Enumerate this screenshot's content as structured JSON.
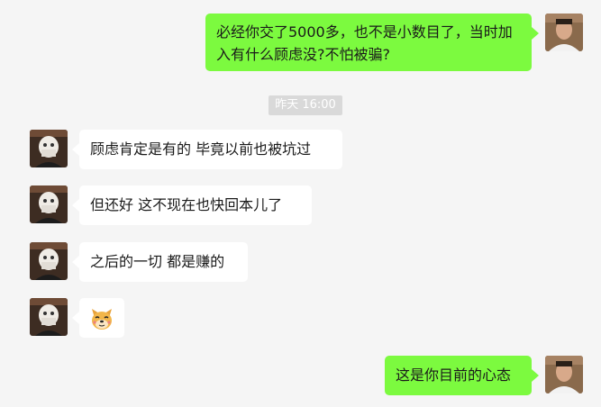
{
  "chat": {
    "timestamp": "昨天 16:00",
    "messages": [
      {
        "sender": "me",
        "text": "必经你交了5000多，也不是小数目了，当时加入有什么顾虑没?不怕被骗?"
      },
      {
        "sender": "other",
        "text": "顾虑肯定是有的 毕竟以前也被坑过"
      },
      {
        "sender": "other",
        "text": "但还好 这不现在也快回本儿了"
      },
      {
        "sender": "other",
        "text": "之后的一切 都是赚的"
      },
      {
        "sender": "other",
        "emoji": "doge-face-emoji"
      },
      {
        "sender": "me",
        "text": "这是你目前的心态"
      }
    ]
  },
  "colors": {
    "my_bubble": "#7cfa3f",
    "other_bubble": "#ffffff",
    "background": "#f5f5f5",
    "timestamp_bg": "#d9d9d9"
  }
}
